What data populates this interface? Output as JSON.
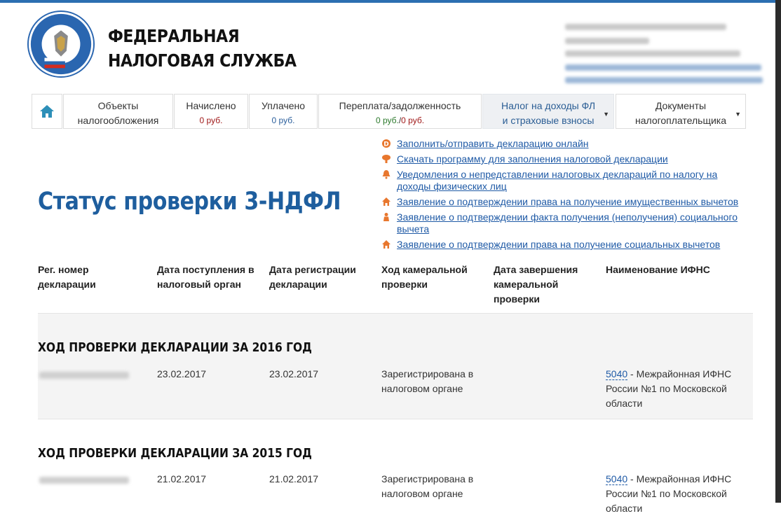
{
  "brand": {
    "line1": "ФЕДЕРАЛЬНАЯ",
    "line2": "НАЛОГОВАЯ СЛУЖБА",
    "seal_text": "ФЕДЕРАЛЬНАЯ НАЛОГОВАЯ СЛУЖБА"
  },
  "tabs": [
    {
      "icon": "home-icon"
    },
    {
      "line1": "Объекты",
      "line2": "налогообложения"
    },
    {
      "line1": "Начислено",
      "amount": "0 руб."
    },
    {
      "line1": "Уплачено",
      "amount": "0 руб."
    },
    {
      "line1": "Переплата/задолженность",
      "amount_a": "0 руб.",
      "sep": "/",
      "amount_b": "0 руб."
    },
    {
      "line1": "Налог на доходы ФЛ",
      "line2": "и страховые взносы"
    },
    {
      "line1": "Документы",
      "line2": "налогоплательщика"
    }
  ],
  "links": [
    {
      "icon": "declaration-d-icon",
      "text": "Заполнить/отправить декларацию онлайн"
    },
    {
      "icon": "download-icon",
      "text": "Скачать программу для заполнения налоговой декларации"
    },
    {
      "icon": "bell-icon",
      "text": "Уведомления о непредставлении налоговых деклараций по налогу на доходы физических лиц"
    },
    {
      "icon": "house-icon",
      "text": "Заявление о подтверждении права на получение имущественных вычетов"
    },
    {
      "icon": "person-icon",
      "text": "Заявление о подтверждении факта получения (неполучения) социального вычета"
    },
    {
      "icon": "house-icon",
      "text": "Заявление о подтверждении права на получение социальных вычетов"
    }
  ],
  "page_title": "Статус проверки 3-НДФЛ",
  "table": {
    "columns": [
      "Рег. номер декларации",
      "Дата поступления в налоговый орган",
      "Дата регистрации декларации",
      "Ход камеральной проверки",
      "Дата завершения камеральной проверки",
      "Наименование ИФНС"
    ],
    "sections": [
      {
        "title": "ХОД ПРОВЕРКИ ДЕКЛАРАЦИИ ЗА 2016 ГОД",
        "received": "23.02.2017",
        "registered": "23.02.2017",
        "status": "Зарегистрирована в налоговом органе",
        "completed": "",
        "ifns_code": "5040",
        "ifns_name": " - Межрайонная ИФНС России №1 по Московской области"
      },
      {
        "title": "ХОД ПРОВЕРКИ ДЕКЛАРАЦИИ ЗА 2015 ГОД",
        "received": "21.02.2017",
        "registered": "21.02.2017",
        "status": "Зарегистрирована в налоговом органе",
        "completed": "",
        "ifns_code": "5040",
        "ifns_name": " - Межрайонная ИФНС России №1 по Московской области"
      }
    ]
  },
  "colors": {
    "accent": "#1e5e9e",
    "link": "#1f5aa6",
    "icon_orange": "#e8772e",
    "charged_red": "#a01919"
  }
}
